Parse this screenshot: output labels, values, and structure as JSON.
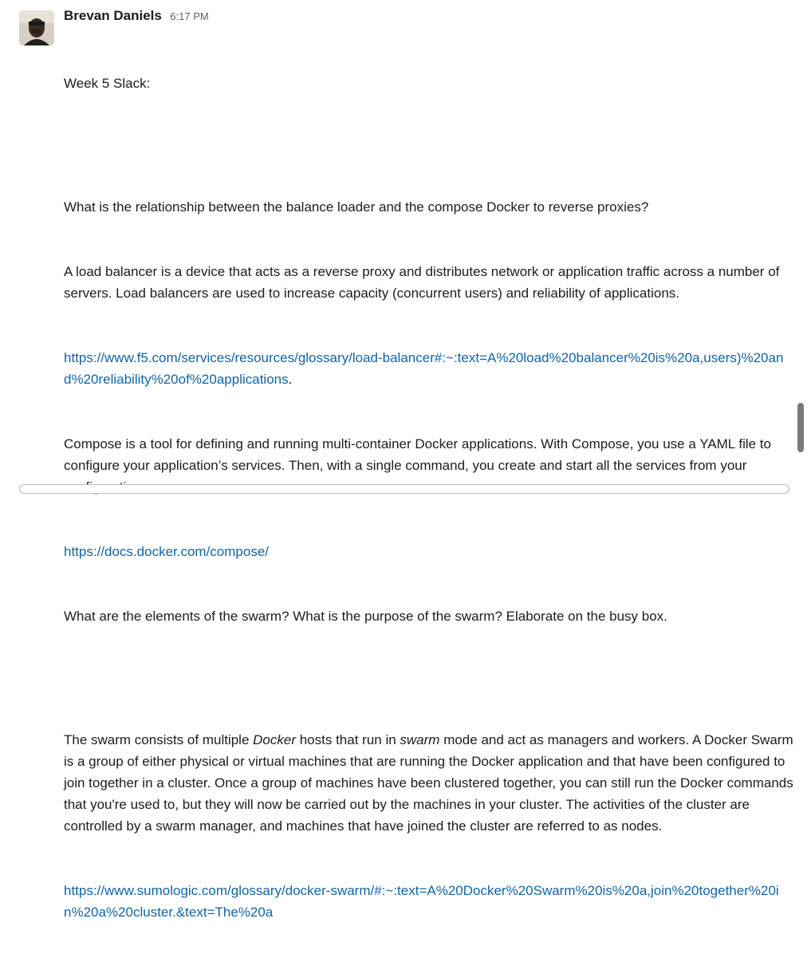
{
  "message": {
    "author": "Brevan Daniels",
    "time": "6:17 PM",
    "title": "Week 5 Slack:",
    "q1": "What is the relationship between the balance loader and the compose Docker to reverse proxies?",
    "a1": "A load balancer is a device that acts as a reverse proxy and distributes network or application traffic across a number of servers. Load balancers are used to increase capacity (concurrent users) and reliability of applications.",
    "link1": "https://www.f5.com/services/resources/glossary/load-balancer#:~:text=A%20load%20balancer%20is%20a,users)%20and%20reliability%20of%20applications",
    "link1_trail": ".",
    "a2": "Compose is a tool for defining and running multi-container Docker applications. With Compose, you use a YAML file to configure your application’s services. Then, with a single command, you create and start all the services from your configuration.",
    "link2": "https://docs.docker.com/compose/",
    "q2": "What are the elements of the swarm? What is the purpose of the swarm? Elaborate on the busy box.",
    "a3_pre": "The swarm consists of multiple ",
    "a3_em1": "Docker",
    "a3_mid": " hosts that run in ",
    "a3_em2": "swarm",
    "a3_post": " mode and act as managers and workers. A Docker Swarm is a group of either physical or virtual machines that are running the Docker application and that have been configured to join together in a cluster. Once a group of machines have been clustered together, you can still run the Docker commands that you're used to, but they will now be carried out by the machines in your cluster. The activities of the cluster are controlled by a swarm manager, and machines that have joined the cluster are referred to as nodes.",
    "link3": "https://www.sumologic.com/glossary/docker-swarm/#:~:text=A%20Docker%20Swarm%20is%20a,join%20together%20in%20a%20cluster.&text=The%20a"
  }
}
